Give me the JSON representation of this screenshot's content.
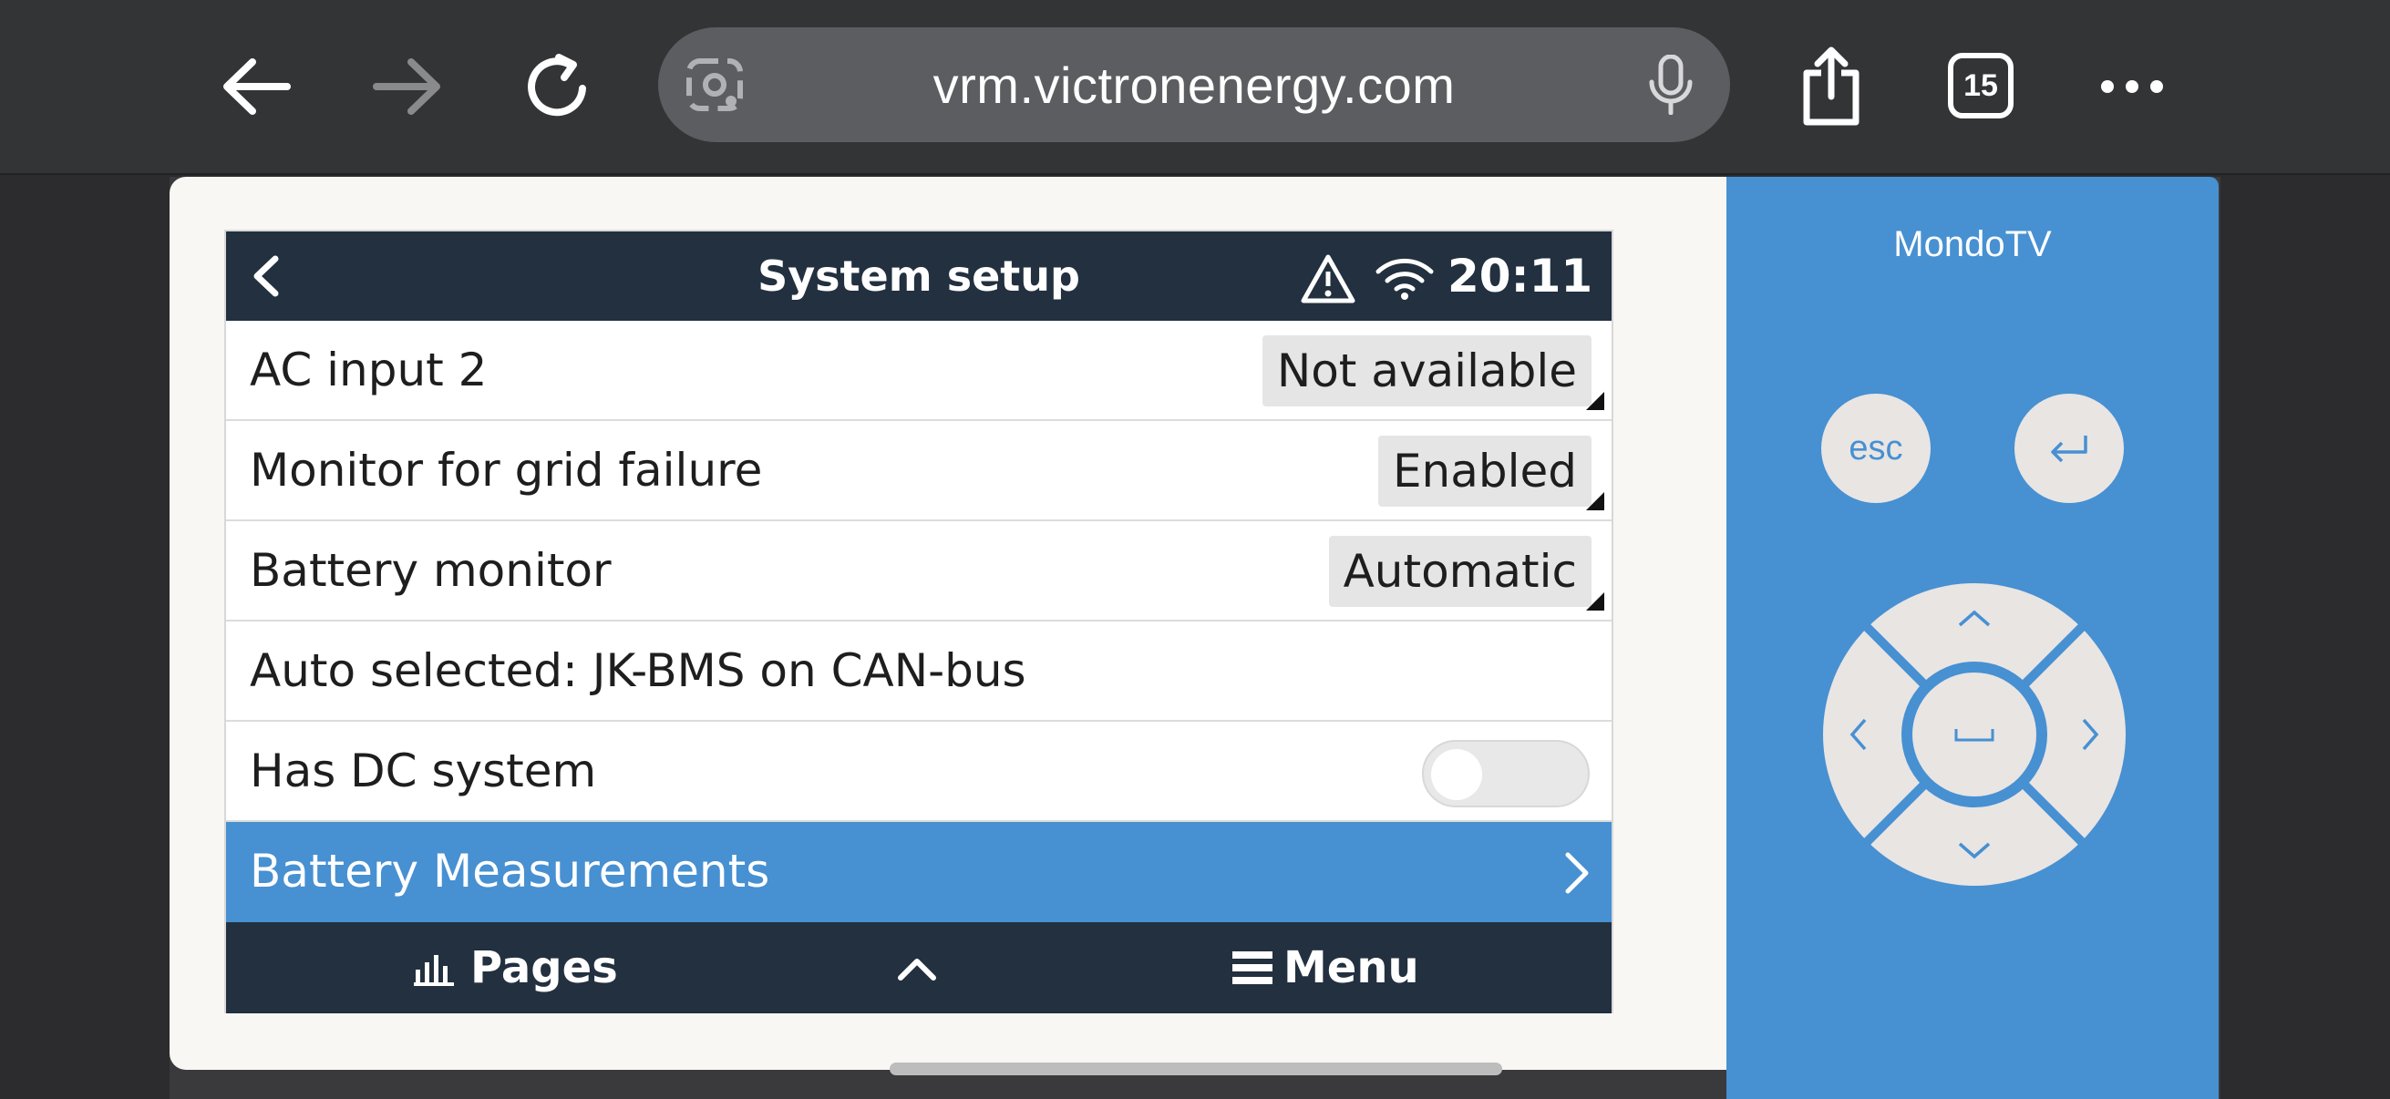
{
  "browser": {
    "url": "vrm.victronenergy.com",
    "tab_count": "15"
  },
  "remote": {
    "title": "MondoTV",
    "esc_label": "esc"
  },
  "gx": {
    "title": "System setup",
    "clock": "20:11",
    "rows": [
      {
        "label": "AC input 2",
        "value": "Not available"
      },
      {
        "label": "Monitor for grid failure",
        "value": "Enabled"
      },
      {
        "label": "Battery monitor",
        "value": "Automatic"
      },
      {
        "label": "Auto selected: JK-BMS on CAN-bus"
      },
      {
        "label": "Has DC system",
        "toggle_on": false
      },
      {
        "label": "Battery Measurements"
      }
    ],
    "footer": {
      "pages_label": "Pages",
      "menu_label": "Menu"
    }
  },
  "colors": {
    "header_bg": "#22303f",
    "accent": "#4790d2",
    "browser_bg": "#333436"
  }
}
